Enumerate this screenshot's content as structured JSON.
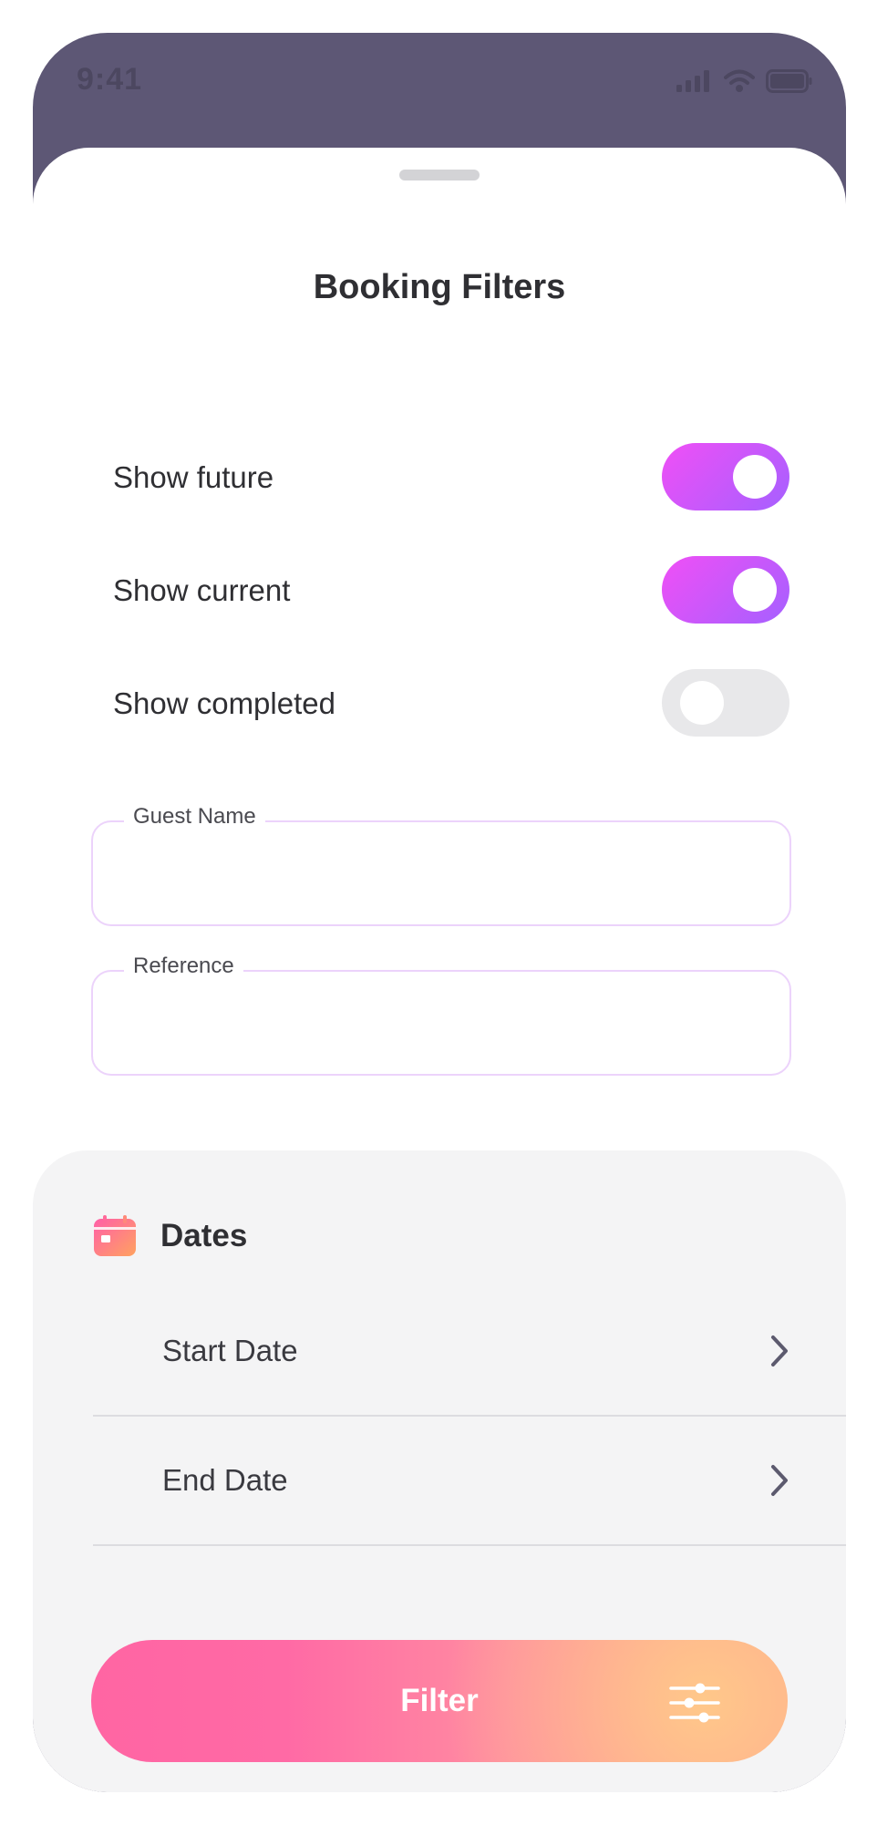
{
  "status_bar": {
    "time": "9:41"
  },
  "sheet": {
    "title": "Booking Filters"
  },
  "toggles": [
    {
      "label": "Show future",
      "on": true
    },
    {
      "label": "Show current",
      "on": true
    },
    {
      "label": "Show completed",
      "on": false
    }
  ],
  "fields": {
    "guest_name": {
      "label": "Guest Name",
      "value": ""
    },
    "reference": {
      "label": "Reference",
      "value": ""
    }
  },
  "dates": {
    "title": "Dates",
    "start_label": "Start Date",
    "end_label": "End Date"
  },
  "filter_button": {
    "label": "Filter"
  },
  "colors": {
    "toggle_on_start": "#f04ff6",
    "toggle_on_end": "#a560ff",
    "toggle_off": "#e8e8ea",
    "field_border": "#ecd3fb",
    "button_start": "#ff65a3",
    "button_end": "#ffa090",
    "backdrop": "#5d5775"
  },
  "icons": {
    "grabber": "sheet-grabber",
    "dates": "calendar-icon",
    "row_arrow": "chevron-right-icon",
    "filter": "sliders-icon"
  }
}
